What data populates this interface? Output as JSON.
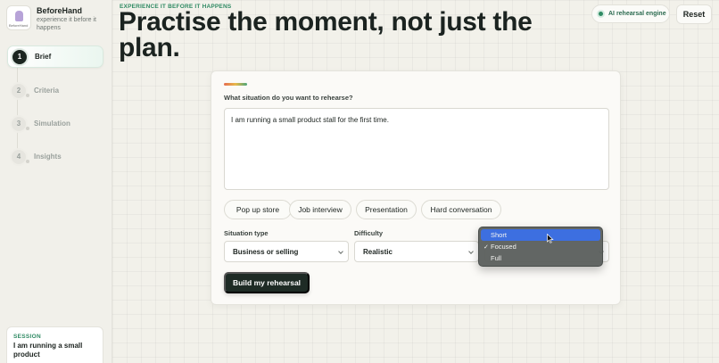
{
  "brand": {
    "name": "BeforeHand",
    "tagline": "experience it before it happens",
    "logo_caption": "BeforeHand"
  },
  "steps": [
    {
      "num": "1",
      "label": "Brief",
      "active": true
    },
    {
      "num": "2",
      "label": "Criteria",
      "active": false
    },
    {
      "num": "3",
      "label": "Simulation",
      "active": false
    },
    {
      "num": "4",
      "label": "Insights",
      "active": false
    }
  ],
  "session": {
    "label": "SESSION",
    "text": "I am running a small product"
  },
  "header": {
    "eyebrow": "EXPERIENCE IT BEFORE IT HAPPENS",
    "headline": "Practise the moment, not just the plan.",
    "engine_badge": "AI rehearsal engine",
    "reset_label": "Reset"
  },
  "form": {
    "question": "What situation do you want to rehearse?",
    "situation_text": "I am running a small product stall for the first time.",
    "chips": [
      "Pop up store",
      "Job interview",
      "Presentation",
      "Hard conversation"
    ],
    "situation_type_label": "Situation type",
    "situation_type_value": "Business or selling",
    "difficulty_label": "Difficulty",
    "difficulty_value": "Realistic",
    "build_label": "Build my rehearsal"
  },
  "dropdown": {
    "options": [
      "Short",
      "Focused",
      "Full"
    ],
    "highlighted": "Short",
    "checked": "Focused",
    "check_mark": "✓"
  },
  "colors": {
    "accent_green": "#2f8a63",
    "primary_dark": "#1e2b25",
    "highlight_blue": "#3d6fe0"
  }
}
